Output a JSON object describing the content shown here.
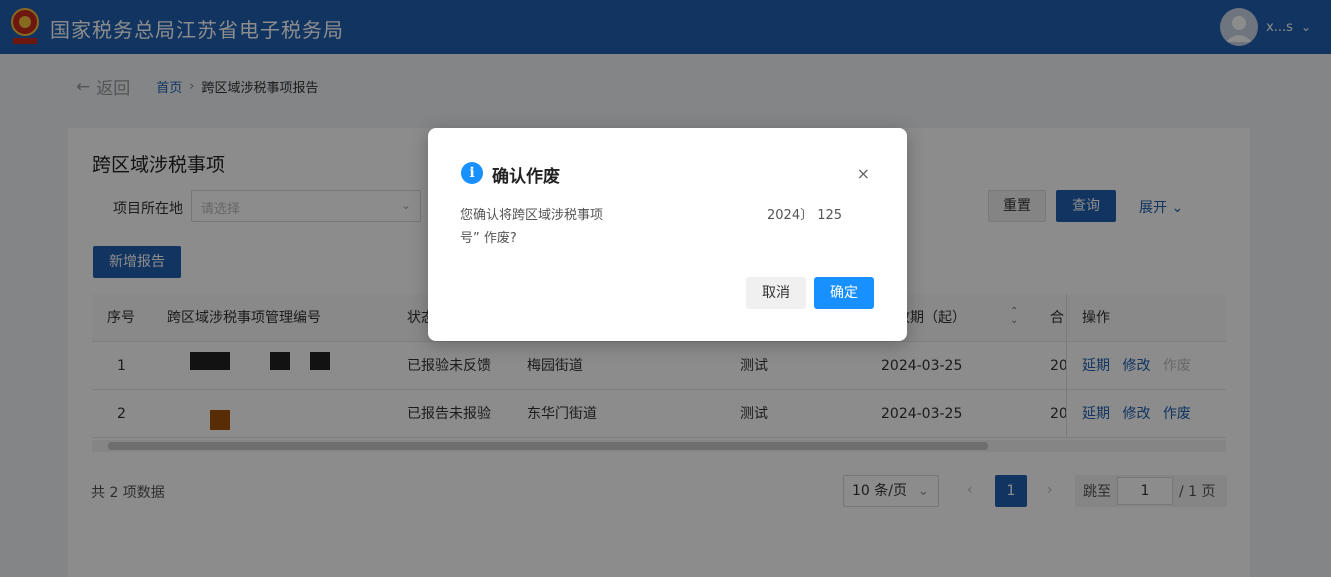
{
  "header": {
    "app_title": "国家税务总局江苏省电子税务局",
    "username": "x...s"
  },
  "breadcrumb": {
    "back_label": "返回",
    "home": "首页",
    "separator": "›",
    "current": "跨区域涉税事项报告"
  },
  "page": {
    "title": "跨区域涉税事项",
    "filter_label": "项目所在地",
    "select_placeholder": "请选择",
    "reset_label": "重置",
    "query_label": "查询",
    "expand_label": "展开",
    "add_label": "新增报告"
  },
  "table": {
    "headers": {
      "index": "序号",
      "code": "跨区域涉税事项管理编号",
      "status": "状态",
      "valid_from": "有效期（起）",
      "contract_short": "合",
      "ops": "操作"
    },
    "rows": [
      {
        "index": "1",
        "status": "已报验未反馈",
        "street": "梅园街道",
        "name": "测试",
        "date": "2024-03-25",
        "col_short": "20",
        "op1": "延期",
        "op2": "修改",
        "op3": "作废"
      },
      {
        "index": "2",
        "status": "已报告未报验",
        "street": "东华门街道",
        "name": "测试",
        "date": "2024-03-25",
        "col_short": "20",
        "op1": "延期",
        "op2": "修改",
        "op3": "作废"
      }
    ]
  },
  "pagination": {
    "total": "共 2 项数据",
    "page_size": "10 条/页",
    "current_page": "1",
    "jump_label": "跳至",
    "jump_value": "1",
    "total_pages": "/ 1 页"
  },
  "dialog": {
    "title": "确认作废",
    "message_line1": "您确认将跨区域涉税事项",
    "message_line1_end": "2024〕 125",
    "message_line2": "号” 作废?",
    "cancel_label": "取消",
    "ok_label": "确定"
  },
  "colors": {
    "header_bg": "#1f5fb0",
    "primary": "#1890ff",
    "overlay": "rgba(0,0,0,0.45)"
  }
}
